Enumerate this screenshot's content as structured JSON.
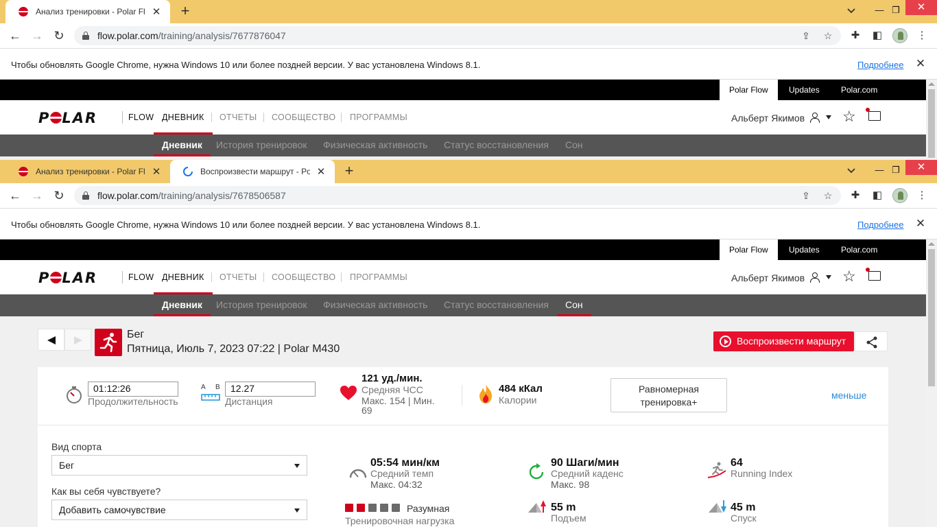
{
  "colors": {
    "brand": "#d0021b",
    "chrome_frame": "#f2c96a",
    "link": "#1a73e8"
  },
  "window1": {
    "tabs": [
      {
        "title": "Анализ тренировки - Polar Flow",
        "icon": "polar-favicon"
      }
    ],
    "url_host": "flow.polar.com",
    "url_path": "/training/analysis/7677876047"
  },
  "window2": {
    "tabs": [
      {
        "title": "Анализ тренировки - Polar Flow",
        "icon": "polar-favicon"
      },
      {
        "title": "Воспроизвести маршрут - Polar",
        "icon": "loading-icon"
      }
    ],
    "url_host": "flow.polar.com",
    "url_path": "/training/analysis/7678506587"
  },
  "infobar": {
    "message": "Чтобы обновлять Google Chrome, нужна Windows 10 или более поздней версии. У вас установлена Windows 8.1.",
    "link": "Подробнее"
  },
  "site": {
    "topbar": [
      "Polar Flow",
      "Updates",
      "Polar.com"
    ],
    "logo": "POLAR",
    "nav": [
      "FLOW",
      "ДНЕВНИК",
      "ОТЧЕТЫ",
      "СООБЩЕСТВО",
      "ПРОГРАММЫ"
    ],
    "user_name": "Альберт Якимов",
    "subnav": [
      "Дневник",
      "История тренировок",
      "Физическая активность",
      "Статус восстановления",
      "Сон"
    ]
  },
  "session": {
    "sport": "Бег",
    "subtitle": "Пятница, Июль 7, 2023 07:22 | Polar M430",
    "route_button": "Воспроизвести маршрут"
  },
  "summary": {
    "duration_value": "01:12:26",
    "duration_label": "Продолжительность",
    "distance_value": "12.27",
    "distance_label": "Дистанция",
    "distance_ab": [
      "A",
      "B"
    ],
    "hr_value": "121 уд./мин.",
    "hr_label": "Средняя ЧСС",
    "hr_sub": "Макс. 154  |  Мин.",
    "hr_sub2": "69",
    "calories_value": "484 кКал",
    "calories_label": "Калории",
    "training_type_line1": "Равномерная",
    "training_type_line2": "тренировка+",
    "less_link": "меньше"
  },
  "detail": {
    "sport_field_label": "Вид спорта",
    "sport_field_value": "Бег",
    "feeling_field_label": "Как вы себя чувствуете?",
    "feeling_field_value": "Добавить самочувствие",
    "pace_value": "05:54 мин/км",
    "pace_label": "Средний темп",
    "pace_sub": "Макс. 04:32",
    "cadence_value": "90 Шаги/мин",
    "cadence_label": "Средний каденс",
    "cadence_sub": "Макс. 98",
    "running_index_value": "64",
    "running_index_label": "Running Index",
    "training_load_value": "Разумная",
    "training_load_label": "Тренировочная нагрузка",
    "training_load_level": 2,
    "training_load_max": 5,
    "ascent_value": "55 m",
    "ascent_label": "Подъем",
    "descent_value": "45 m",
    "descent_label": "Спуск"
  }
}
